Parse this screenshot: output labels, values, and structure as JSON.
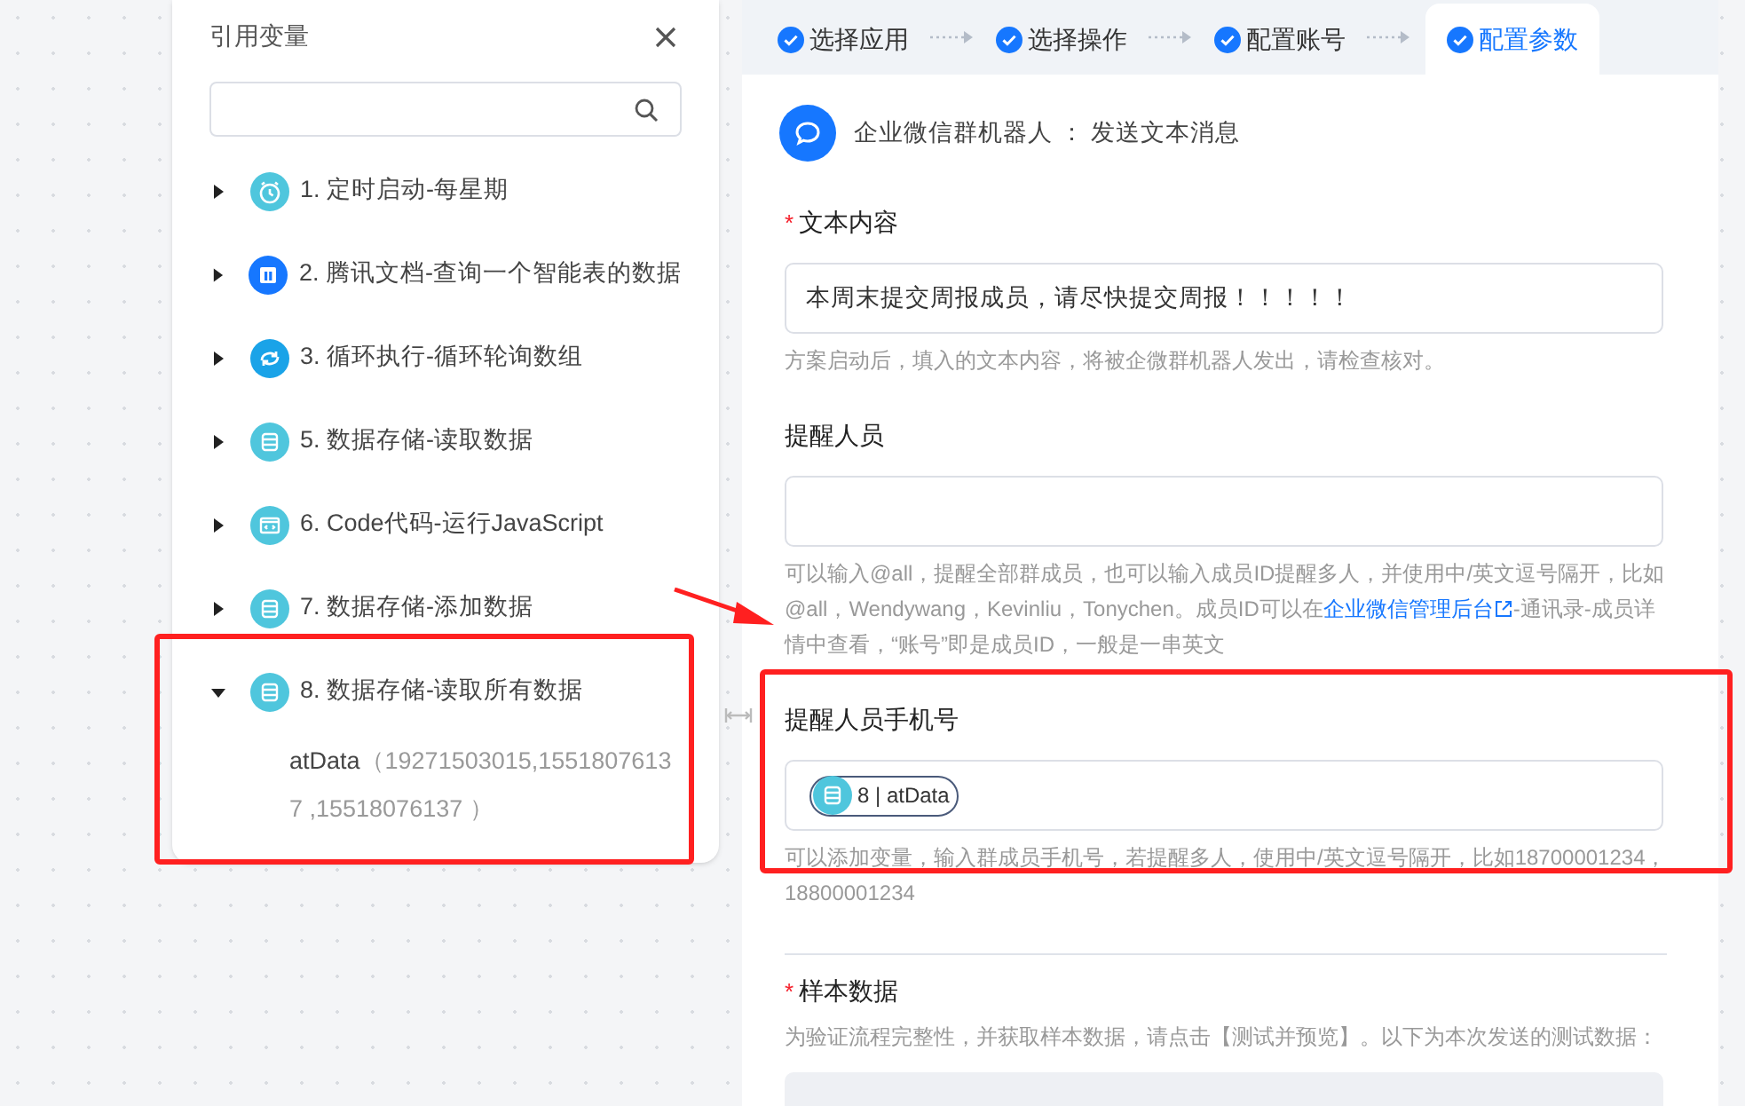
{
  "variables_panel": {
    "title": "引用变量",
    "items": [
      {
        "label": "1. 定时启动-每星期",
        "color": "#4fc6dd",
        "expanded": false
      },
      {
        "label": "2. 腾讯文档-查询一个智能表的数据",
        "color": "#1677ff",
        "expanded": false
      },
      {
        "label": "3. 循环执行-循环轮询数组",
        "color": "#1aa3e8",
        "expanded": false
      },
      {
        "label": "5. 数据存储-读取数据",
        "color": "#4fc6dd",
        "expanded": false
      },
      {
        "label": "6. Code代码-运行JavaScript",
        "color": "#4fc6dd",
        "expanded": false
      },
      {
        "label": "7. 数据存储-添加数据",
        "color": "#4fc6dd",
        "expanded": false
      },
      {
        "label": "8. 数据存储-读取所有数据",
        "color": "#4fc6dd",
        "expanded": true,
        "children": [
          {
            "name": "atData",
            "value": "（19271503015,15518076137 ,15518076137 ）"
          }
        ]
      }
    ]
  },
  "steps": [
    {
      "label": "选择应用",
      "selected": false
    },
    {
      "label": "选择操作",
      "selected": false
    },
    {
      "label": "配置账号",
      "selected": false
    },
    {
      "label": "配置参数",
      "selected": true
    }
  ],
  "header": {
    "app": "企业微信群机器人",
    "separator": "：",
    "action": "发送文本消息"
  },
  "fields": [
    {
      "kind": "text",
      "label": "文本内容",
      "required_mark": "*",
      "value": "本周末提交周报成员，请尽快提交周报！！！！！",
      "hint": [
        {
          "text": "方案启动后，填入的文本内容，将被企微群机器人发出，请检查核对。"
        }
      ]
    },
    {
      "kind": "text",
      "label": "提醒人员",
      "hint": [
        {
          "text": "可以输入@all，提醒全部群成员，也可以输入成员ID提醒多人，并使用中/英文逗号隔开，比如@all，Wendywang，Kevinliu，Tonychen。成员ID可以在"
        },
        {
          "text": "企业微信管理后台",
          "link": true
        },
        {
          "text": "-通讯录-成员详情中查看，“账号”即是成员ID，一般是一串英文"
        }
      ]
    },
    {
      "kind": "tags",
      "label": "提醒人员手机号",
      "tags": [
        "8 | atData"
      ],
      "hint": [
        {
          "text": "可以添加变量，输入群成员手机号，若提醒多人，使用中/英文逗号隔开，比如18700001234，18800001234"
        }
      ]
    },
    {
      "kind": "sample",
      "label": "样本数据",
      "required_mark": "*",
      "hint": [
        {
          "text": "为验证流程完整性，并获取样本数据，请点击【测试并预览】。以下为本次发送的测试数据："
        }
      ]
    }
  ]
}
